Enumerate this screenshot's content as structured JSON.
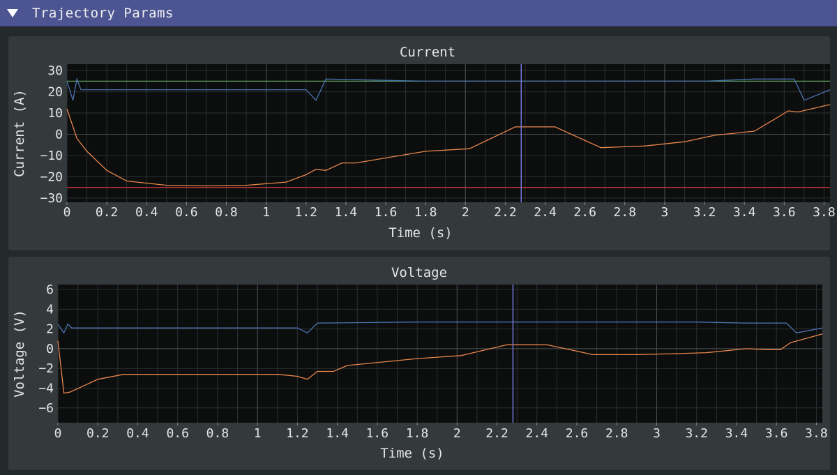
{
  "window": {
    "title": "Trajectory Params"
  },
  "colors": {
    "plot_bg": "#0c0d0d",
    "grid": "#2c3133",
    "zero_axis": "#4a4f52",
    "series_blue": "#4a72b0",
    "series_orange": "#e8874c",
    "series_green": "#5fa35f",
    "series_red": "#c0353a",
    "cursor": "#7a7ae0"
  },
  "chart_data": [
    {
      "type": "line",
      "title": "Current",
      "xlabel": "Time (s)",
      "ylabel": "Current (A)",
      "xlim": [
        0,
        3.83
      ],
      "ylim": [
        -32,
        33
      ],
      "grid": true,
      "cursor_x": 2.28,
      "x_ticks": [
        0,
        0.2,
        0.4,
        0.6,
        0.8,
        1,
        1.2,
        1.4,
        1.6,
        1.8,
        2,
        2.2,
        2.4,
        2.6,
        2.8,
        3,
        3.2,
        3.4,
        3.6,
        3.8
      ],
      "x_tick_labels": [
        "0",
        "0.2",
        "0.4",
        "0.6",
        "0.8",
        "1",
        "1.2",
        "1.4",
        "1.6",
        "1.8",
        "2",
        "2.2",
        "2.4",
        "2.6",
        "2.8",
        "3",
        "3.2",
        "3.4",
        "3.6",
        "3.8"
      ],
      "y_ticks": [
        30,
        20,
        10,
        0,
        -10,
        -20,
        -30
      ],
      "y_tick_labels": [
        "30",
        "20",
        "10",
        "0",
        "−10",
        "−20",
        "−30"
      ],
      "series": [
        {
          "color": "#5fa35f",
          "x": [
            0,
            3.83
          ],
          "y": [
            25,
            25
          ]
        },
        {
          "color": "#c0353a",
          "x": [
            0,
            3.83
          ],
          "y": [
            -25,
            -25
          ]
        },
        {
          "color": "#4a72b0",
          "x": [
            0,
            0.03,
            0.05,
            0.07,
            1.2,
            1.25,
            1.3,
            1.8,
            3.2,
            3.45,
            3.65,
            3.7,
            3.83
          ],
          "y": [
            25,
            16,
            26,
            21,
            21,
            16,
            26,
            25,
            25,
            26,
            26,
            16,
            21
          ]
        },
        {
          "color": "#e8874c",
          "x": [
            0,
            0.05,
            0.1,
            0.2,
            0.3,
            0.5,
            0.7,
            0.9,
            1.1,
            1.2,
            1.25,
            1.3,
            1.38,
            1.45,
            1.8,
            2.02,
            2.25,
            2.45,
            2.68,
            2.9,
            3.1,
            3.25,
            3.45,
            3.55,
            3.62,
            3.67,
            3.83
          ],
          "y": [
            12,
            -2,
            -8,
            -17,
            -22,
            -24,
            -24.3,
            -24,
            -22.5,
            -19,
            -16.5,
            -17,
            -13.5,
            -13.5,
            -8,
            -6.8,
            3.5,
            3.5,
            -6.3,
            -5.5,
            -3.5,
            -0.5,
            1.5,
            7,
            11,
            10.5,
            14
          ]
        }
      ]
    },
    {
      "type": "line",
      "title": "Voltage",
      "xlabel": "Time (s)",
      "ylabel": "Voltage (V)",
      "xlim": [
        0,
        3.83
      ],
      "ylim": [
        -7.5,
        6.5
      ],
      "grid": true,
      "cursor_x": 2.28,
      "x_ticks": [
        0,
        0.2,
        0.4,
        0.6,
        0.8,
        1,
        1.2,
        1.4,
        1.6,
        1.8,
        2,
        2.2,
        2.4,
        2.6,
        2.8,
        3,
        3.2,
        3.4,
        3.6,
        3.8
      ],
      "x_tick_labels": [
        "0",
        "0.2",
        "0.4",
        "0.6",
        "0.8",
        "1",
        "1.2",
        "1.4",
        "1.6",
        "1.8",
        "2",
        "2.2",
        "2.4",
        "2.6",
        "2.8",
        "3",
        "3.2",
        "3.4",
        "3.6",
        "3.8"
      ],
      "y_ticks": [
        6,
        4,
        2,
        0,
        -2,
        -4,
        -6
      ],
      "y_tick_labels": [
        "6",
        "4",
        "2",
        "0",
        "−2",
        "−4",
        "−6"
      ],
      "series": [
        {
          "color": "#4a72b0",
          "x": [
            0,
            0.03,
            0.05,
            0.07,
            1.2,
            1.25,
            1.3,
            1.8,
            3.2,
            3.45,
            3.65,
            3.7,
            3.83
          ],
          "y": [
            2.5,
            1.6,
            2.5,
            2.1,
            2.1,
            1.6,
            2.6,
            2.7,
            2.7,
            2.6,
            2.6,
            1.6,
            2.1
          ]
        },
        {
          "color": "#e8874c",
          "x": [
            0,
            0.03,
            0.06,
            0.2,
            0.33,
            0.5,
            0.8,
            1.1,
            1.2,
            1.25,
            1.3,
            1.38,
            1.45,
            1.8,
            2.02,
            2.25,
            2.45,
            2.68,
            2.9,
            3.1,
            3.25,
            3.45,
            3.55,
            3.62,
            3.67,
            3.83
          ],
          "y": [
            0.8,
            -4.5,
            -4.4,
            -3.1,
            -2.6,
            -2.6,
            -2.6,
            -2.6,
            -2.8,
            -3.1,
            -2.3,
            -2.3,
            -1.7,
            -1.0,
            -0.7,
            0.4,
            0.4,
            -0.6,
            -0.6,
            -0.5,
            -0.4,
            0.0,
            -0.1,
            -0.1,
            0.6,
            1.5
          ]
        }
      ]
    }
  ]
}
